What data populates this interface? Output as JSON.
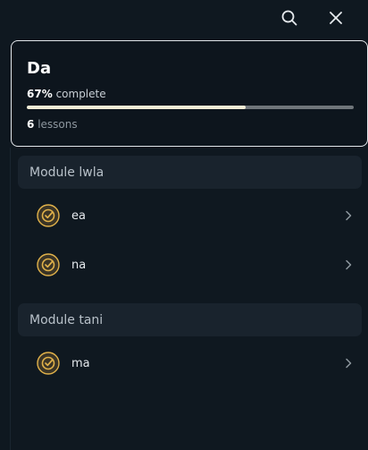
{
  "course": {
    "title": "Da",
    "progress_percent": "67%",
    "progress_label": "complete",
    "progress_fraction": 0.67,
    "lesson_count": "6",
    "lessons_label": "lessons"
  },
  "modules": [
    {
      "title": "Module lwla",
      "lessons": [
        {
          "title": "ea",
          "status_icon": "check-circle-icon"
        },
        {
          "title": "na",
          "status_icon": "check-circle-icon"
        }
      ]
    },
    {
      "title": "Module tani",
      "lessons": [
        {
          "title": "ma",
          "status_icon": "check-circle-icon"
        }
      ]
    }
  ],
  "colors": {
    "background": "#0f1820",
    "accent_gold": "#e0b14a",
    "progress_fill": "#f1ecd6",
    "progress_track": "#6f757a",
    "module_header_bg": "#19232d"
  },
  "icons": {
    "search": "search-icon",
    "close": "close-icon",
    "chevron": "chevron-right-icon"
  }
}
